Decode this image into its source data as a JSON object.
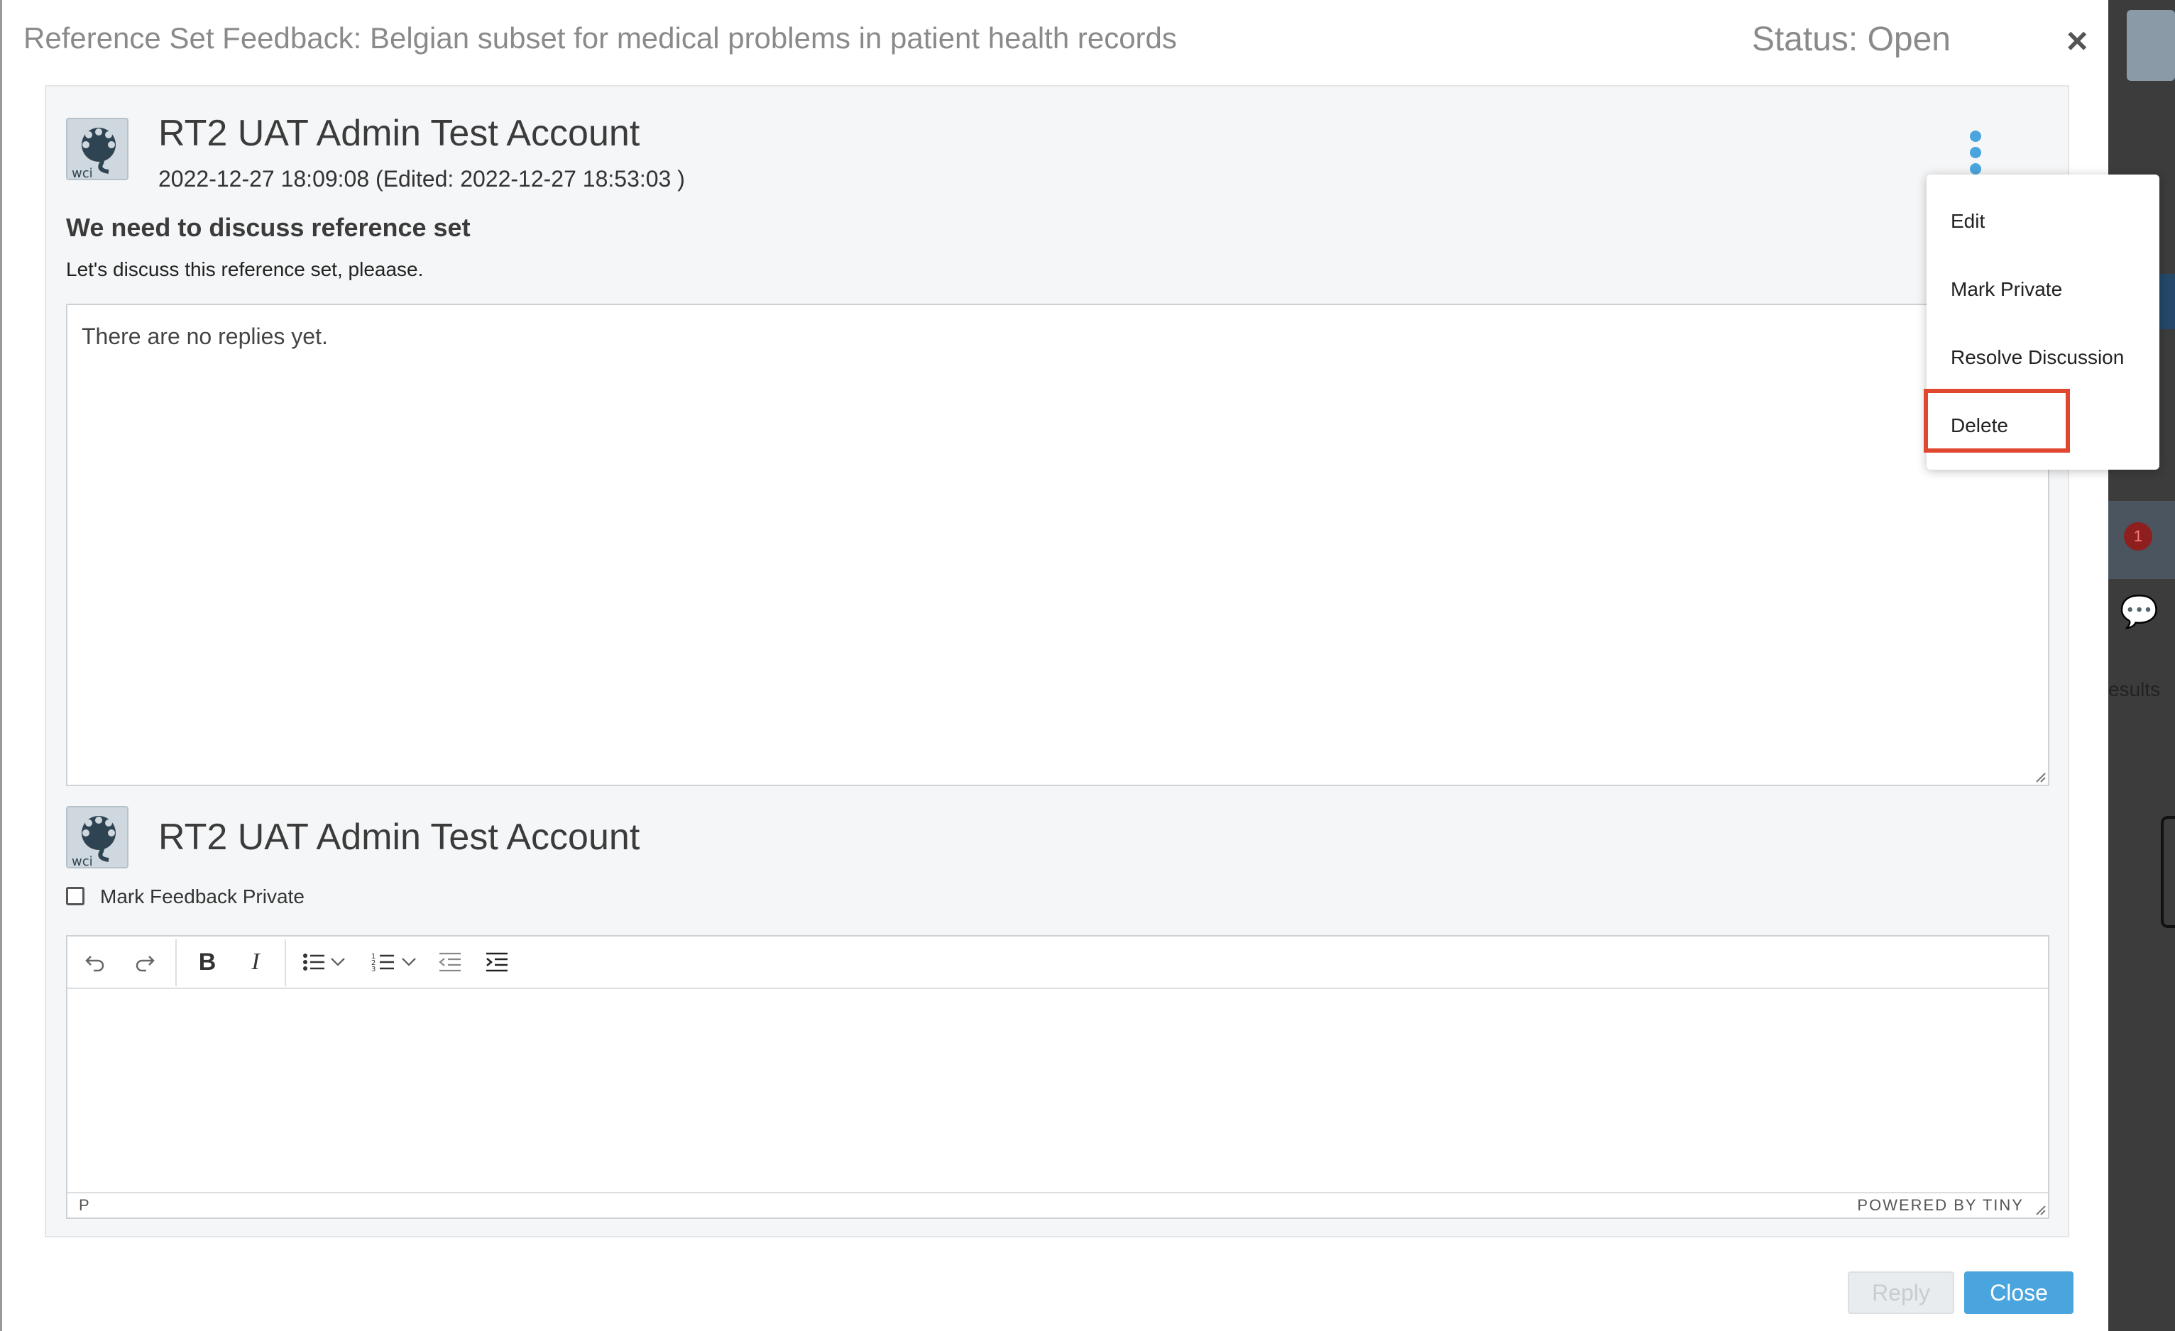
{
  "modal": {
    "title": "Reference Set Feedback: Belgian subset for medical problems in patient health records",
    "status": "Status: Open",
    "close_icon": "×"
  },
  "comment": {
    "author": "RT2 UAT Admin Test Account",
    "timestamp": "2022-12-27 18:09:08 (Edited: 2022-12-27 18:53:03 )",
    "heading": "We need to discuss reference set",
    "body": "Let's discuss this reference set, pleaase.",
    "avatar_text": "wci"
  },
  "replies": {
    "empty_text": "There are no replies yet."
  },
  "reply_form": {
    "author": "RT2 UAT Admin Test Account",
    "avatar_text": "wci",
    "private_label": "Mark Feedback Private",
    "editor": {
      "toolbar_icons": [
        "undo-icon",
        "redo-icon",
        "bold-icon",
        "italic-icon",
        "bullet-list-icon",
        "chevron-down-icon",
        "numbered-list-icon",
        "chevron-down-icon",
        "outdent-icon",
        "indent-icon"
      ],
      "bold_label": "B",
      "italic_label": "I",
      "path": "P",
      "brand": "POWERED BY TINY"
    }
  },
  "buttons": {
    "reply": "Reply",
    "close": "Close"
  },
  "menu": {
    "items": [
      {
        "label": "Edit"
      },
      {
        "label": "Mark Private"
      },
      {
        "label": "Resolve Discussion"
      },
      {
        "label": "Delete"
      }
    ]
  },
  "background": {
    "badge_count": "1",
    "partial_text": "esults",
    "logo_text": "wci"
  },
  "colors": {
    "accent": "#4aa4dd",
    "highlight": "#e0472f",
    "title_gray": "#8a8a8a"
  }
}
